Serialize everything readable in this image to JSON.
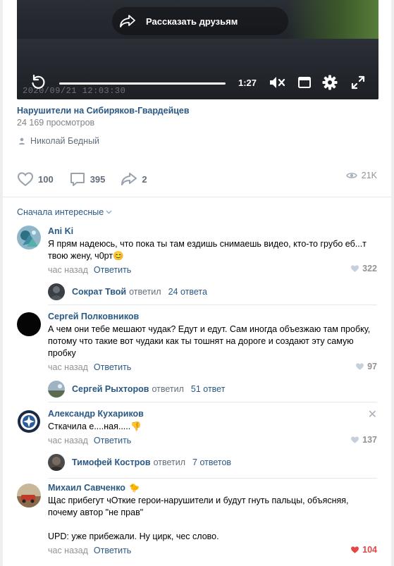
{
  "video": {
    "share_label": "Рассказать друзьям",
    "timestamp": "2020/09/21 12:03:30",
    "duration": "1:27",
    "progress": 1.0,
    "title": "Нарушители на Сибиряков-Гвардейцев",
    "views": "24 169 просмотров",
    "author": "Николай Бедный"
  },
  "actions": {
    "likes": "100",
    "comments": "395",
    "shares": "2",
    "views": "21K"
  },
  "sort_label": "Сначала интересные",
  "comments": [
    {
      "name": "Ani Ki",
      "text": "Я прям надеюсь, что пока ты там ездишь снимаешь видео, кто-то грубо еб...т твою жену, ч0рт😊",
      "time": "час назад",
      "reply": "Ответить",
      "likes": "322",
      "thread": {
        "name": "Сократ Твой",
        "verb": "ответил",
        "count": "24 ответа"
      }
    },
    {
      "name": "Сергей Полковников",
      "text": "А чем они тебе мешают чудак? Едут и едут. Сам иногда объезжаю там пробку, потому что такие вот чудаки как ты тошнят на дороге и создают эту самую пробку",
      "time": "час назад",
      "reply": "Ответить",
      "likes": "97",
      "thread": {
        "name": "Сергей Рыхторов",
        "verb": "ответил",
        "count": "51 ответ"
      }
    },
    {
      "name": "Александр Кухариков",
      "text": "Сткачила е....ная.....👎",
      "time": "час назад",
      "reply": "Ответить",
      "likes": "137",
      "thread": {
        "name": "Тимофей Костров",
        "verb": "ответил",
        "count": "7 ответов"
      }
    },
    {
      "name": "Михаил Савченко",
      "text": "Щас прибегут чОткие герои-нарушители и будут гнуть пальцы, объясняя, почему автор \"не прав\"",
      "text2": "UPD: уже прибежали. Ну цирк, чес слово.",
      "time": "час назад",
      "reply": "Ответить",
      "likes": "104"
    }
  ],
  "colors": {
    "link": "#2a5885",
    "muted": "#939393",
    "liked": "#e64646"
  }
}
